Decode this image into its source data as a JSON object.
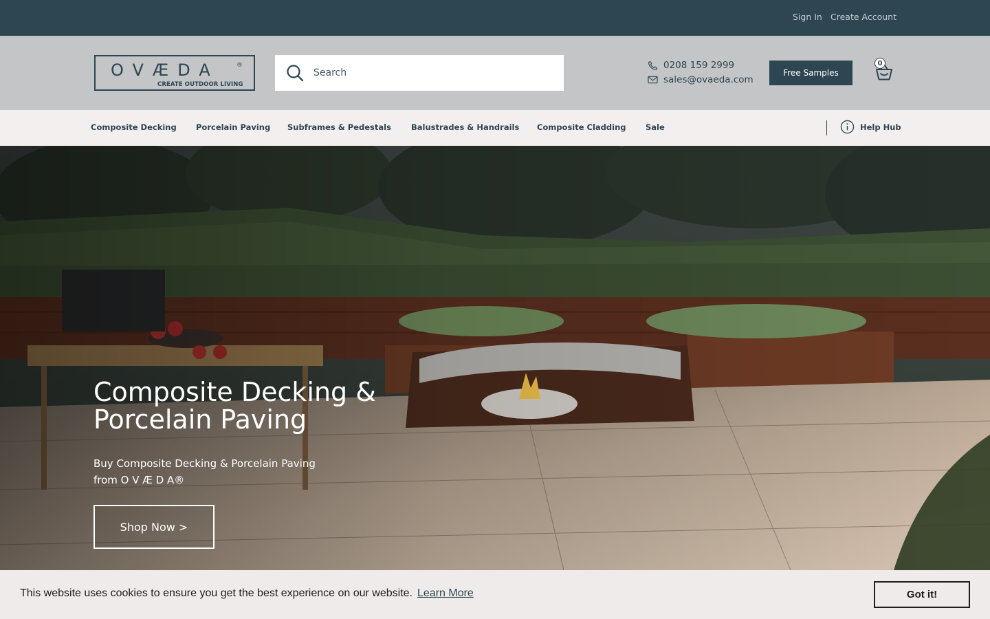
{
  "topbar": {
    "sign_in": "Sign In",
    "create_account": "Create Account"
  },
  "header": {
    "logo": {
      "wordmark": "OVÆDA",
      "registered": "®",
      "tagline": "CREATE OUTDOOR LIVING"
    },
    "search": {
      "placeholder": "Search",
      "value": ""
    },
    "contact": {
      "phone": "0208 159 2999",
      "email": "sales@ovaeda.com"
    },
    "free_samples_label": "Free Samples",
    "basket_count": "0"
  },
  "nav": {
    "items": [
      {
        "label": "Composite Decking"
      },
      {
        "label": "Porcelain Paving"
      },
      {
        "label": "Subframes & Pedestals"
      },
      {
        "label": "Balustrades & Handrails"
      },
      {
        "label": "Composite Cladding"
      },
      {
        "label": "Sale"
      }
    ],
    "help_hub": "Help Hub"
  },
  "hero": {
    "title": "Composite Decking & Porcelain Paving",
    "subtitle": "Buy Composite Decking & Porcelain Paving from O V Æ D A®",
    "cta": "Shop Now >"
  },
  "cookie": {
    "message": "This website uses cookies to ensure you get the best experience on our website.",
    "learn_more": "Learn More",
    "accept": "Got it!"
  },
  "colors": {
    "brand_dark": "#2e4552",
    "header_bg": "#c3c5c6",
    "nav_bg": "#f2efee",
    "cookie_bg": "#efebea"
  }
}
